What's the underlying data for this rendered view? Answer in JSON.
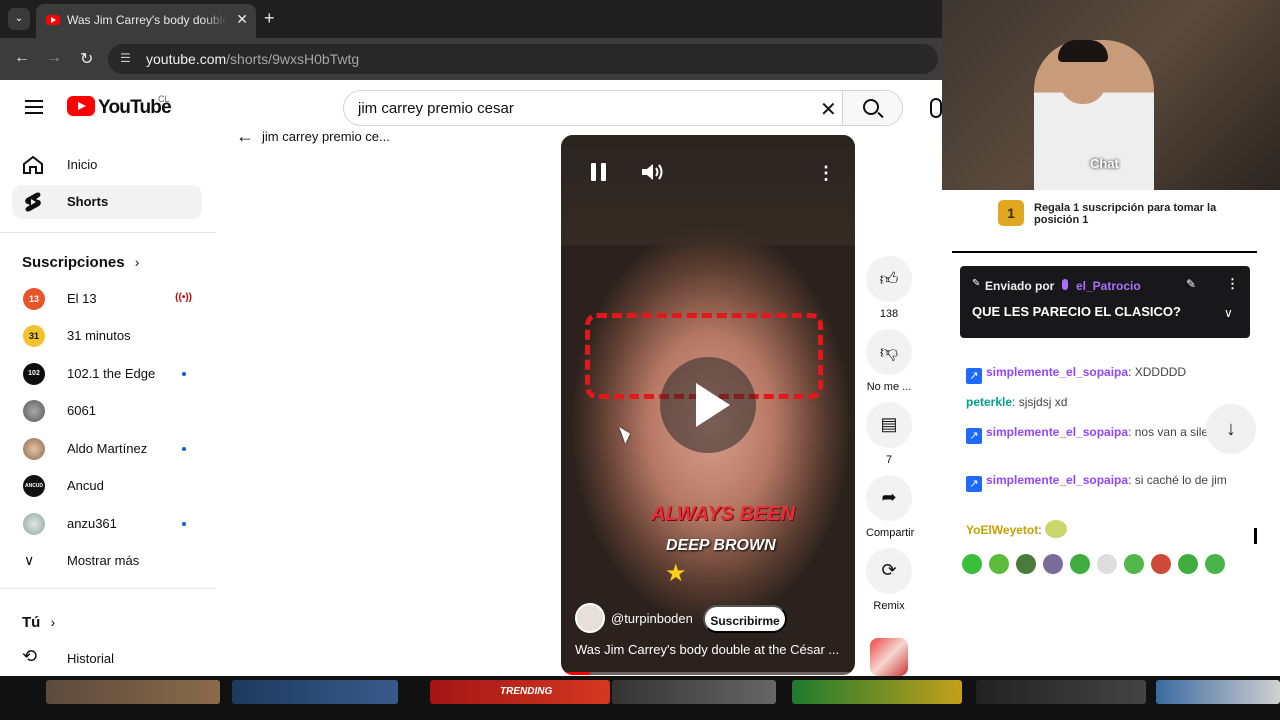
{
  "browser": {
    "tab_title": "Was Jim Carrey's body double a",
    "url_host": "youtube.com",
    "url_path": "/shorts/9wxsH0bTwtg"
  },
  "youtube": {
    "wordmark": "YouTube",
    "country": "CL",
    "search_value": "jim carrey premio cesar",
    "back_label": "jim carrey premio ce..."
  },
  "sidebar": {
    "items": [
      {
        "label": "Inicio",
        "icon": "home-icon"
      },
      {
        "label": "Shorts",
        "icon": "shorts-icon",
        "active": true
      }
    ],
    "subscriptions_title": "Suscripciones",
    "subscriptions": [
      {
        "label": "El 13",
        "color": "#e8542a",
        "avatar_text": "13",
        "live": true
      },
      {
        "label": "31 minutos",
        "color": "#1a1a1a",
        "avatar_text": "31"
      },
      {
        "label": "102.1 the Edge",
        "color": "#0c0c0c",
        "avatar_text": "102",
        "new": true
      },
      {
        "label": "6061",
        "color": "#7d7d7d",
        "avatar_text": ""
      },
      {
        "label": "Aldo Martínez",
        "color": "#c9a27e",
        "avatar_text": "",
        "new": true
      },
      {
        "label": "Ancud",
        "color": "#111111",
        "avatar_text": "ANCUD"
      },
      {
        "label": "anzu361",
        "color": "#b9c7c0",
        "avatar_text": "",
        "new": true
      }
    ],
    "show_more": "Mostrar más",
    "you_title": "Tú",
    "history": "Historial"
  },
  "video": {
    "channel": "@turpinboden",
    "subscribe": "Suscribirme",
    "title": "Was Jim Carrey's body double at the César ...",
    "caption_1": "ALWAYS BEEN",
    "caption_2": "DEEP BROWN",
    "progress": 0.1
  },
  "actions": {
    "like_count": "138",
    "dislike_label": "No me ...",
    "comments_count": "7",
    "share_label": "Compartir",
    "remix_label": "Remix"
  },
  "stream": {
    "chat_word": "Chat",
    "gift_rank": "1",
    "gift_text": "Regala 1 suscripción para tomar la posición 1",
    "pinned_sent_by": "Enviado por",
    "pinned_user": "el_Patrocio",
    "pinned_message": "QUE LES PARECIO EL CLASICO?",
    "chat_lines": [
      {
        "user": "simplemente_el_sopaipa",
        "color": "#9146ff",
        "text": ": XDDDDD",
        "badge": true
      },
      {
        "user": "peterkle",
        "color": "#00a38b",
        "text": ": sjsjdsj xd",
        "badge": false
      },
      {
        "user": "simplemente_el_sopaipa",
        "color": "#9146ff",
        "text": ": nos van a silenciar",
        "badge": true
      },
      {
        "user": "simplemente_el_sopaipa",
        "color": "#9146ff",
        "text": ": si caché lo de jim",
        "badge": true
      },
      {
        "user": "YoElWeyetot",
        "color": "#c4a200",
        "text": ":",
        "badge": false
      }
    ],
    "emote_colors": [
      "#3bbf3b",
      "#5dbb3a",
      "#4a7b3a",
      "#7a6b9a",
      "#3fae3f",
      "#dddddd",
      "#52b84a",
      "#d04a3a",
      "#3fae3f",
      "#48b54a"
    ]
  },
  "taskbar": {
    "thumb_text": "TRENDING"
  }
}
